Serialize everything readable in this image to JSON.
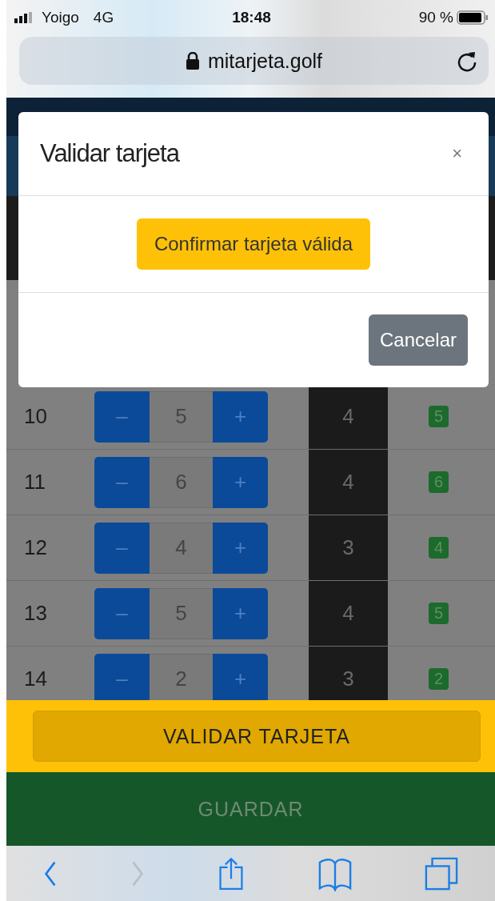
{
  "status_bar": {
    "carrier": "Yoigo",
    "network": "4G",
    "time": "18:48",
    "battery": "90 %"
  },
  "address_bar": {
    "url": "mitarjeta.golf"
  },
  "holes": [
    {
      "hole": "10",
      "minus": "–",
      "strokes": "5",
      "plus": "+",
      "par": "4",
      "score": "5"
    },
    {
      "hole": "11",
      "minus": "–",
      "strokes": "6",
      "plus": "+",
      "par": "4",
      "score": "6"
    },
    {
      "hole": "12",
      "minus": "–",
      "strokes": "4",
      "plus": "+",
      "par": "3",
      "score": "4"
    },
    {
      "hole": "13",
      "minus": "–",
      "strokes": "5",
      "plus": "+",
      "par": "4",
      "score": "5"
    },
    {
      "hole": "14",
      "minus": "–",
      "strokes": "2",
      "plus": "+",
      "par": "3",
      "score": "2"
    }
  ],
  "modal": {
    "title": "Validar tarjeta",
    "close": "×",
    "confirm_button": "Confirmar tarjeta válida",
    "cancel_button": "Cancelar"
  },
  "validate_button": "VALIDAR TARJETA",
  "save_button": {
    "label": "GUARDAR",
    "disabled": true
  },
  "toolbar": [
    {
      "kind": "back",
      "disabled": false
    },
    {
      "kind": "forward",
      "disabled": true
    },
    {
      "kind": "share",
      "disabled": false
    },
    {
      "kind": "bookmarks",
      "disabled": false
    },
    {
      "kind": "tabs",
      "disabled": false
    }
  ]
}
